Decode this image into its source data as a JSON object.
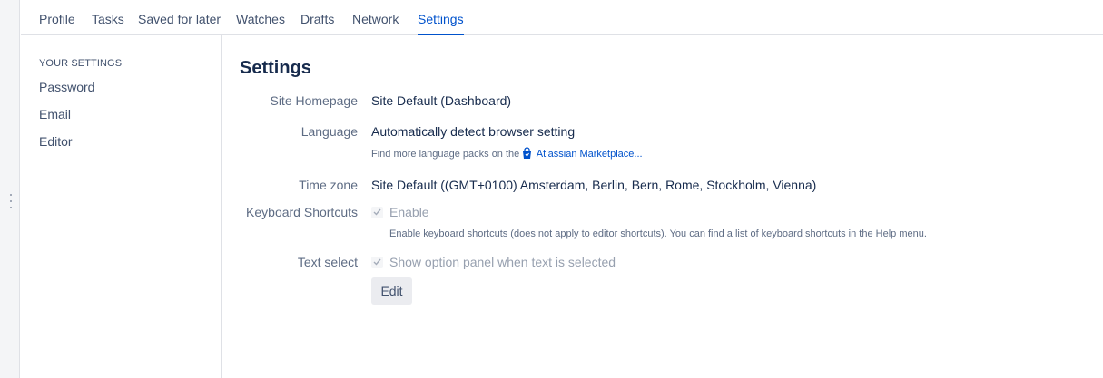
{
  "tabs": [
    {
      "label": "Profile"
    },
    {
      "label": "Tasks"
    },
    {
      "label": "Saved for later"
    },
    {
      "label": "Watches"
    },
    {
      "label": "Drafts"
    },
    {
      "label": "Network"
    },
    {
      "label": "Settings",
      "active": true
    }
  ],
  "sidebar": {
    "heading": "YOUR SETTINGS",
    "items": [
      {
        "label": "Password"
      },
      {
        "label": "Email"
      },
      {
        "label": "Editor"
      }
    ]
  },
  "main": {
    "title": "Settings",
    "site_homepage": {
      "label": "Site Homepage",
      "value": "Site Default (Dashboard)"
    },
    "language": {
      "label": "Language",
      "value": "Automatically detect browser setting",
      "hint_prefix": "Find more language packs on the",
      "hint_link": "Atlassian Marketplace..."
    },
    "time_zone": {
      "label": "Time zone",
      "value": "Site Default ((GMT+0100) Amsterdam, Berlin, Bern, Rome, Stockholm, Vienna)"
    },
    "keyboard_shortcuts": {
      "label": "Keyboard Shortcuts",
      "checkbox_label": "Enable",
      "checked": true,
      "description": "Enable keyboard shortcuts (does not apply to editor shortcuts). You can find a list of keyboard shortcuts in the Help menu."
    },
    "text_select": {
      "label": "Text select",
      "checkbox_label": "Show option panel when text is selected",
      "checked": true
    },
    "edit_button": "Edit"
  },
  "icons": {
    "marketplace": "atlassian-marketplace-icon",
    "checkmark": "checkmark-icon",
    "rail_handle": "drag-handle-icon"
  },
  "colors": {
    "accent": "#0052cc",
    "text": "#172b4d",
    "muted": "#5e6c84",
    "disabled": "#97a0af"
  }
}
